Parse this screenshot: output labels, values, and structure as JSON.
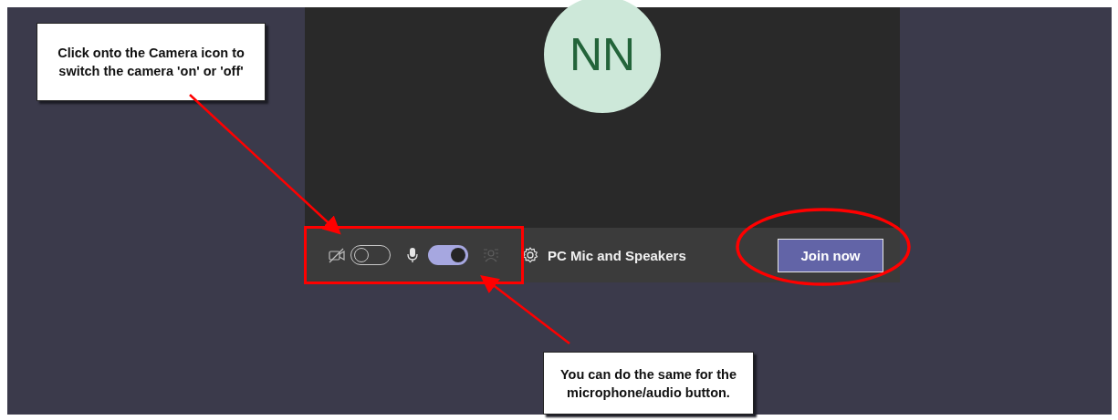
{
  "avatar": {
    "initials": "NN"
  },
  "controls": {
    "camera": {
      "on": false
    },
    "microphone": {
      "on": true
    },
    "device_label": "PC Mic and Speakers",
    "join_button": "Join now"
  },
  "callouts": [
    {
      "text": "Click onto the Camera icon to switch the camera 'on' or 'off'"
    },
    {
      "text": "You can do the same for the microphone/audio button."
    }
  ]
}
